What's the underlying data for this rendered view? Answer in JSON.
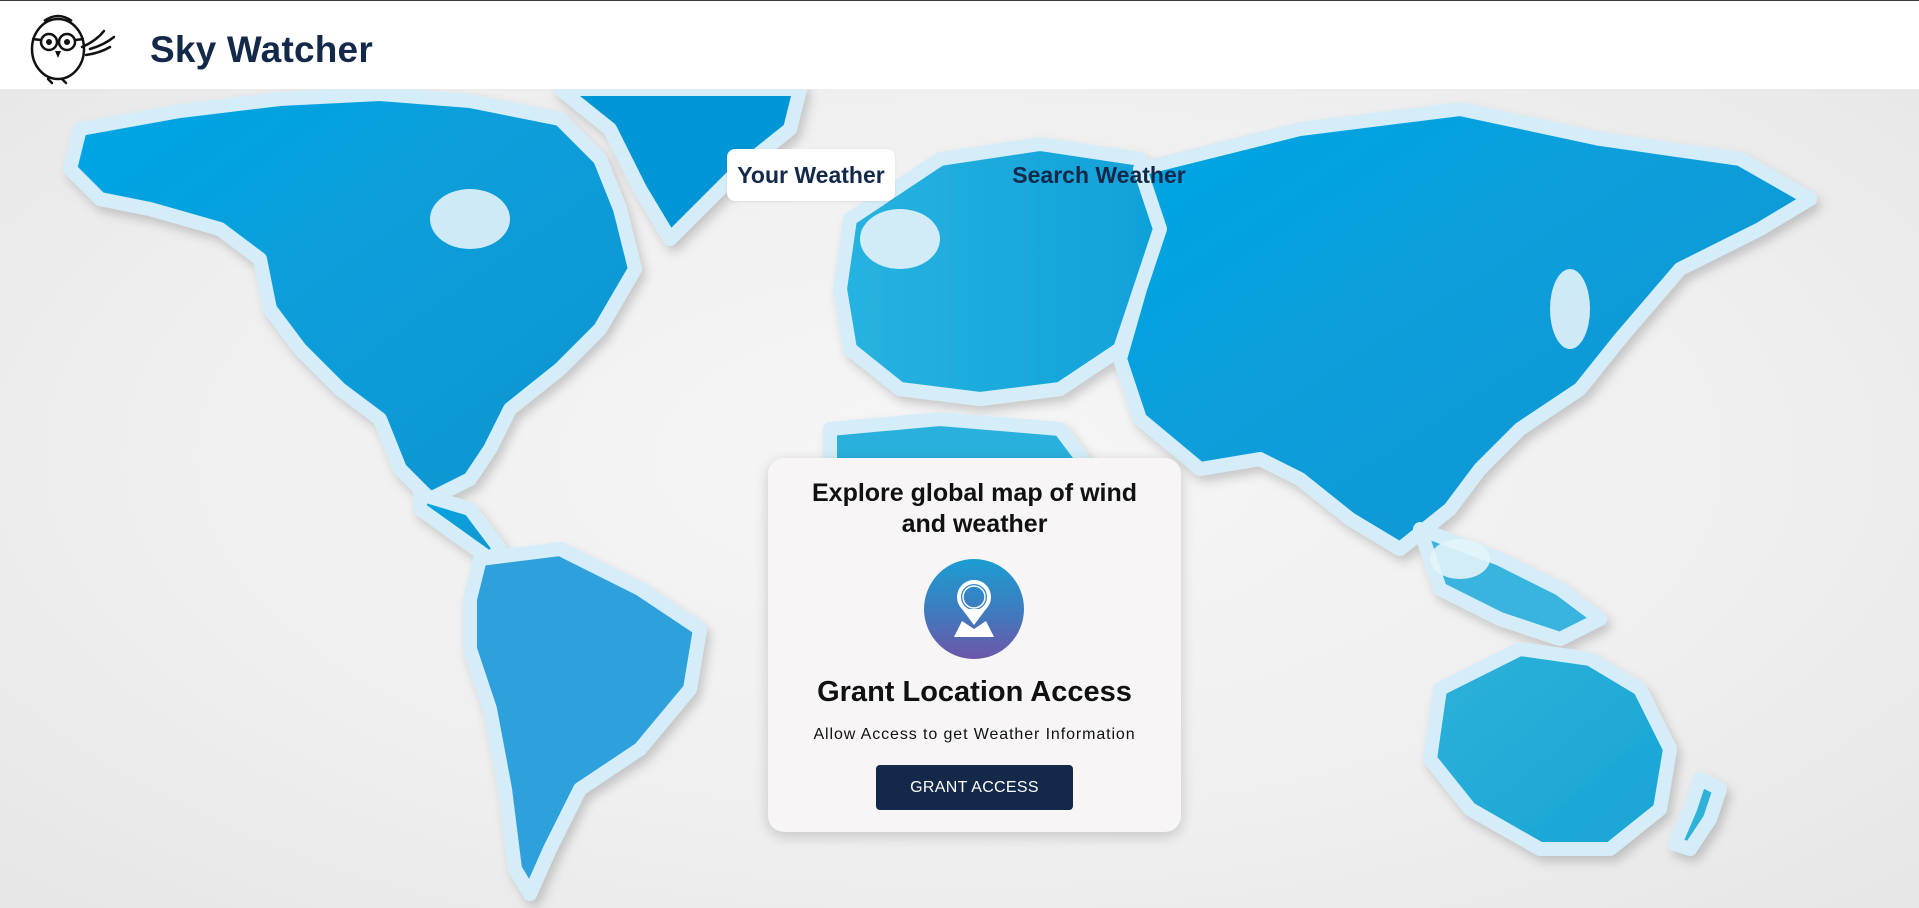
{
  "app": {
    "title": "Sky Watcher",
    "logo_icon": "owl-logo-icon"
  },
  "tabs": [
    {
      "label": "Your Weather",
      "active": true
    },
    {
      "label": "Search Weather",
      "active": false
    }
  ],
  "card": {
    "heading": "Explore global map of wind and weather",
    "icon": "location-pin-icon",
    "title": "Grant Location Access",
    "subtitle": "Allow Access to get Weather Information",
    "button_label": "GRANT ACCESS"
  },
  "colors": {
    "brand_navy": "#14294a",
    "map_blue": "#0aa6e0",
    "land_outline": "#d4edf8"
  }
}
